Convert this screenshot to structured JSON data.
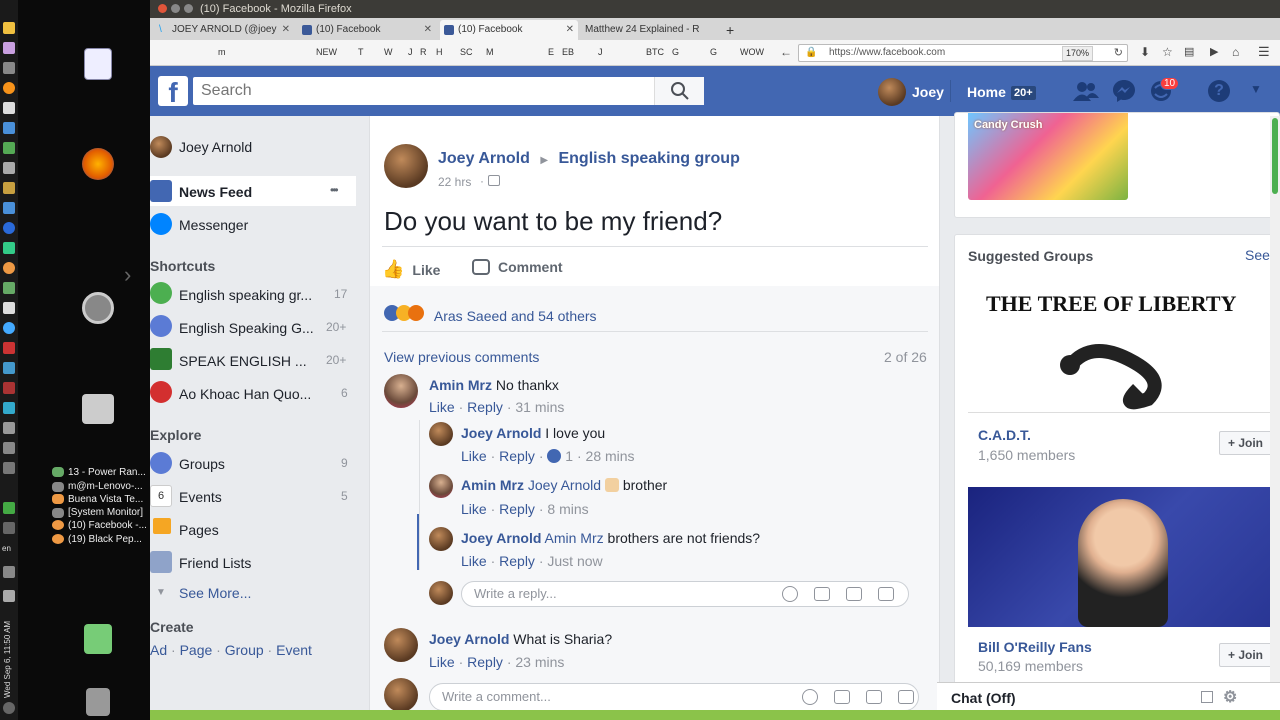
{
  "os": {
    "clock": "Wed Sep 6, 11:50 AM",
    "locale": "en",
    "window_list": [
      "13 - Power Ran...",
      "m@m-Lenovo-...",
      "Buena Vista Te...",
      "[System Monitor]",
      "(10) Facebook -...",
      "(19) Black Pep..."
    ]
  },
  "window": {
    "title": "(10) Facebook - Mozilla Firefox"
  },
  "browser": {
    "tabs": [
      {
        "label": "JOEY ARNOLD (@joey"
      },
      {
        "label": "(10) Facebook"
      },
      {
        "label": "(10) Facebook"
      },
      {
        "label": "Matthew 24 Explained - R"
      }
    ],
    "new_tab": "+",
    "bookmarks": [
      "m",
      "NEW",
      "T",
      "W",
      "J",
      "R",
      "H",
      "SC",
      "M",
      "E",
      "EB",
      "J",
      "BTC",
      "G",
      "G",
      "WOW"
    ],
    "url": "https://www.facebook.com",
    "zoom": "170%"
  },
  "fb": {
    "search_placeholder": "Search",
    "user_name": "Joey",
    "home_label": "Home",
    "home_badge": "20+",
    "notif_badge": "10",
    "help": "?",
    "left_nav": {
      "profile": "Joey Arnold",
      "news_feed": "News Feed",
      "more_dots": "•••",
      "messenger": "Messenger",
      "shortcuts_title": "Shortcuts",
      "shortcuts": [
        {
          "label": "English speaking gr...",
          "count": "17"
        },
        {
          "label": "English Speaking G...",
          "count": "20+"
        },
        {
          "label": "SPEAK ENGLISH ...",
          "count": "20+"
        },
        {
          "label": "Ao Khoac Han Quo...",
          "count": "6"
        }
      ],
      "explore_title": "Explore",
      "explore": [
        {
          "label": "Groups",
          "count": "9"
        },
        {
          "label": "Events",
          "count": "5",
          "icon_text": "6"
        },
        {
          "label": "Pages",
          "count": ""
        },
        {
          "label": "Friend Lists",
          "count": ""
        },
        {
          "label": "See More...",
          "count": ""
        }
      ],
      "create_title": "Create",
      "create_links": [
        "Ad",
        "Page",
        "Group",
        "Event"
      ],
      "create_seps": [
        "·",
        "·",
        "·"
      ]
    },
    "post": {
      "author": "Joey Arnold",
      "arrow": "▶",
      "group": "English speaking group",
      "time": "22 hrs",
      "text": "Do you want to be my friend?",
      "like": "Like",
      "comment": "Comment",
      "reactions": "Aras Saeed and 54 others",
      "view_previous": "View previous comments",
      "comment_count": "2 of 26"
    },
    "comments": [
      {
        "author": "Amin Mrz",
        "text": "No thankx",
        "like": "Like",
        "reply": "Reply",
        "time": "31 mins"
      },
      {
        "author": "Joey Arnold",
        "text": "I love you",
        "like": "Like",
        "reply": "Reply",
        "likes": "1",
        "time": "28 mins"
      },
      {
        "author": "Amin Mrz",
        "tag": "Joey Arnold",
        "text": "brother",
        "like": "Like",
        "reply": "Reply",
        "time": "8 mins"
      },
      {
        "author": "Joey Arnold",
        "tag": "Amin Mrz",
        "text": "brothers are not friends?",
        "like": "Like",
        "reply": "Reply",
        "time": "Just now"
      }
    ],
    "reply_placeholder": "Write a reply...",
    "comment2": {
      "author": "Joey Arnold",
      "text": "What is Sharia?",
      "like": "Like",
      "reply": "Reply",
      "time": "23 mins"
    },
    "comment_placeholder": "Write a comment...",
    "meta_sep": "·",
    "right": {
      "suggested_title": "Suggested Groups",
      "see_all": "See",
      "groups": [
        {
          "banner": "THE TREE OF LIBERTY",
          "name": "C.A.D.T.",
          "members": "1,650 members",
          "join": "+ Join"
        },
        {
          "name": "Bill O'Reilly Fans",
          "members": "50,169 members",
          "join": "+ Join"
        }
      ],
      "candy_text": "Candy Crush"
    },
    "chat": "Chat (Off)"
  }
}
